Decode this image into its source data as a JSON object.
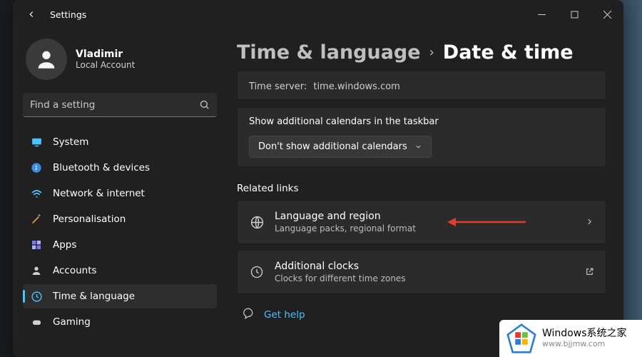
{
  "titlebar": {
    "app_name": "Settings"
  },
  "user": {
    "name": "Vladimir",
    "account_type": "Local Account"
  },
  "search": {
    "placeholder": "Find a setting"
  },
  "nav": {
    "items": [
      {
        "label": "System"
      },
      {
        "label": "Bluetooth & devices"
      },
      {
        "label": "Network & internet"
      },
      {
        "label": "Personalisation"
      },
      {
        "label": "Apps"
      },
      {
        "label": "Accounts"
      },
      {
        "label": "Time & language"
      },
      {
        "label": "Gaming"
      }
    ],
    "active_index": 6
  },
  "breadcrumb": {
    "parent": "Time & language",
    "current": "Date & time"
  },
  "time_server": {
    "label": "Time server:",
    "value": "time.windows.com"
  },
  "calendars_card": {
    "heading": "Show additional calendars in the taskbar",
    "dropdown_value": "Don't show additional calendars"
  },
  "related": {
    "heading": "Related links",
    "items": [
      {
        "title": "Language and region",
        "subtitle": "Language packs, regional format"
      },
      {
        "title": "Additional clocks",
        "subtitle": "Clocks for different time zones"
      }
    ]
  },
  "help": {
    "label": "Get help"
  },
  "watermark": {
    "line1": "Windows系统之家",
    "line2": "www.bjjmw.com"
  }
}
